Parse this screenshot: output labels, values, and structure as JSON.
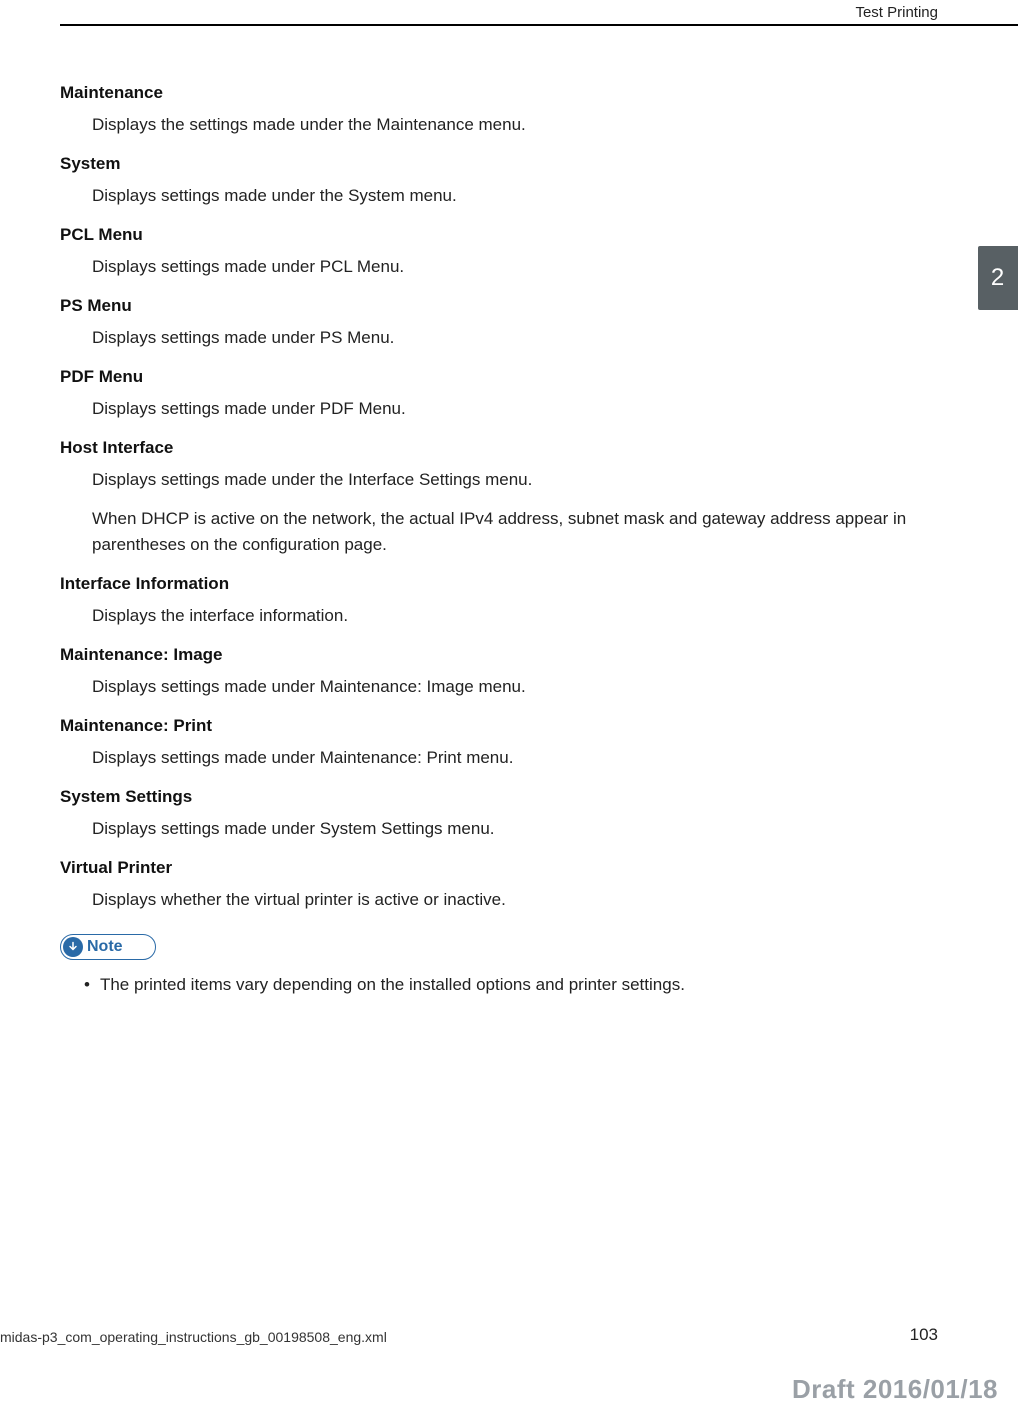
{
  "header": {
    "section_title": "Test Printing"
  },
  "tab": {
    "label": "2"
  },
  "sections": [
    {
      "title": "Maintenance",
      "paras": [
        "Displays the settings made under the Maintenance menu."
      ]
    },
    {
      "title": "System",
      "paras": [
        "Displays settings made under the System menu."
      ]
    },
    {
      "title": "PCL Menu",
      "paras": [
        "Displays settings made under PCL Menu."
      ]
    },
    {
      "title": "PS Menu",
      "paras": [
        "Displays settings made under PS Menu."
      ]
    },
    {
      "title": "PDF Menu",
      "paras": [
        "Displays settings made under PDF Menu."
      ]
    },
    {
      "title": "Host Interface",
      "paras": [
        "Displays settings made under the Interface Settings menu.",
        "When DHCP is active on the network, the actual IPv4 address, subnet mask and gateway address appear in parentheses on the configuration page."
      ]
    },
    {
      "title": "Interface Information",
      "paras": [
        "Displays the interface information."
      ]
    },
    {
      "title": "Maintenance: Image",
      "paras": [
        "Displays settings made under Maintenance: Image menu."
      ]
    },
    {
      "title": "Maintenance: Print",
      "paras": [
        "Displays settings made under Maintenance: Print menu."
      ]
    },
    {
      "title": "System Settings",
      "paras": [
        "Displays settings made under System Settings menu."
      ]
    },
    {
      "title": "Virtual Printer",
      "paras": [
        "Displays whether the virtual printer is active or inactive."
      ]
    }
  ],
  "note": {
    "label": "Note",
    "bullets": [
      "The printed items vary depending on the installed options and printer settings."
    ]
  },
  "footer": {
    "file_ref": "midas-p3_com_operating_instructions_gb_00198508_eng.xml",
    "page_number": "103",
    "draft_stamp": "Draft 2016/01/18"
  }
}
